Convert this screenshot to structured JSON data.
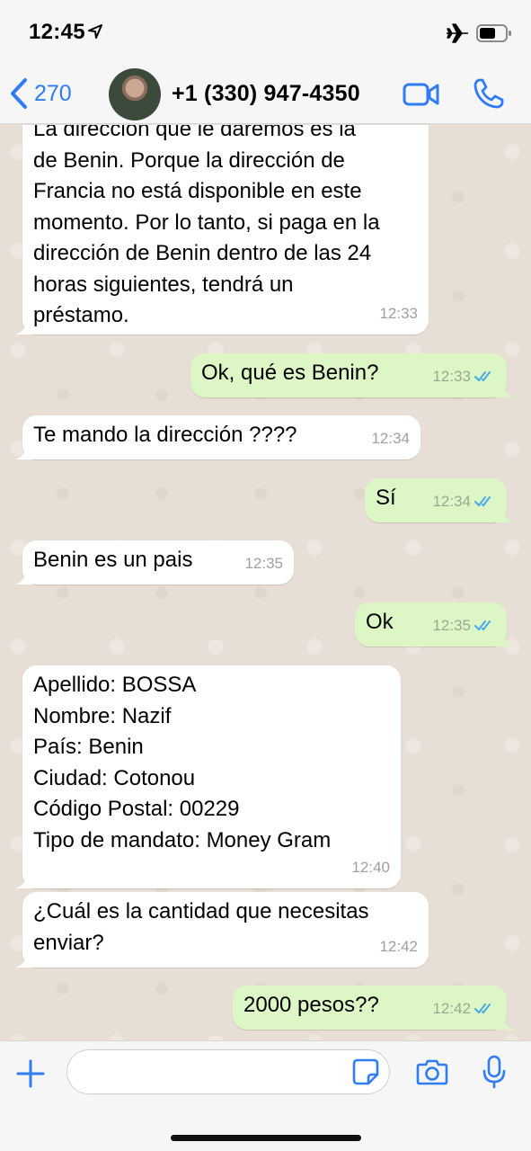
{
  "status_bar": {
    "time": "12:45",
    "icons": [
      "location-arrow-icon",
      "airplane-icon",
      "battery-icon"
    ]
  },
  "header": {
    "back_count": "270",
    "contact_name": "+1 (330) 947-4350",
    "icons": [
      "chevron-left-icon",
      "video-call-icon",
      "phone-icon"
    ]
  },
  "messages": [
    {
      "direction": "incoming",
      "text": "La dirección que le daremos es la\nde Benin. Porque la dirección de\nFrancia no está disponible en este\nmomento. Por lo tanto, si paga en la\ndirección de Benin dentro de las 24\nhoras siguientes, tendrá un\npréstamo.",
      "time": "12:33"
    },
    {
      "direction": "outgoing",
      "text": "Ok, qué es Benin?",
      "time": "12:33",
      "read": true
    },
    {
      "direction": "incoming",
      "text": "Te mando la dirección ????",
      "time": "12:34"
    },
    {
      "direction": "outgoing",
      "text": "Sí",
      "time": "12:34",
      "read": true
    },
    {
      "direction": "incoming",
      "text": "Benin es un pais",
      "time": "12:35"
    },
    {
      "direction": "outgoing",
      "text": "Ok",
      "time": "12:35",
      "read": true
    },
    {
      "direction": "incoming",
      "text": "Apellido: BOSSA\nNombre: Nazif\nPaís: Benin\nCiudad: Cotonou\nCódigo Postal: 00229\nTipo de mandato: Money Gram",
      "time": "12:40"
    },
    {
      "direction": "incoming",
      "text": "¿Cuál es la cantidad que necesitas\nenviar?",
      "time": "12:42"
    },
    {
      "direction": "outgoing",
      "text": "2000 pesos??",
      "time": "12:42",
      "read": true
    }
  ],
  "input_bar": {
    "placeholder": "",
    "icons": [
      "plus-icon",
      "sticker-icon",
      "camera-icon",
      "microphone-icon"
    ]
  },
  "colors": {
    "accent": "#2f7cf6",
    "incoming_bubble": "#ffffff",
    "outgoing_bubble": "#dcf7c5",
    "read_ticks": "#4aa8e8",
    "chat_background": "#e7dfd5"
  }
}
